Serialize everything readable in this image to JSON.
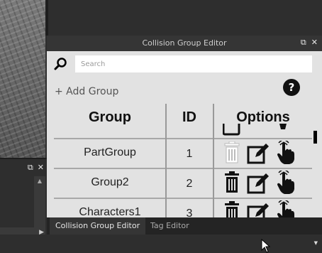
{
  "window": {
    "title": "Collision Group Editor",
    "restore_icon": "⧉",
    "close_icon": "✕"
  },
  "left_panel": {
    "restore_icon": "⧉",
    "close_icon": "✕",
    "scroll_up": "▲",
    "scroll_down": "▼",
    "scroll_right": "▶"
  },
  "search": {
    "placeholder": "Search"
  },
  "toolbar": {
    "add_group_label": "+ Add Group",
    "help_label": "?"
  },
  "table": {
    "headers": {
      "group": "Group",
      "id": "ID",
      "options": "Options"
    },
    "rows": [
      {
        "group": "PartGroup",
        "id": "1",
        "delete_enabled": false
      },
      {
        "group": "Group2",
        "id": "2",
        "delete_enabled": true
      },
      {
        "group": "Characters1",
        "id": "3",
        "delete_enabled": true
      }
    ]
  },
  "tabs": [
    {
      "label": "Collision Group Editor",
      "active": true
    },
    {
      "label": "Tag Editor",
      "active": false
    }
  ],
  "icons": {
    "search": "magnifier-icon",
    "delete": "trash-icon",
    "rename": "edit-icon",
    "select": "hand-pointer-icon"
  },
  "colors": {
    "editor_bg": "#e2e2e2",
    "chrome_bg": "#2e2e2e",
    "title_bg": "#353535"
  },
  "bottom": {
    "dropdown_arrow": "▼"
  }
}
